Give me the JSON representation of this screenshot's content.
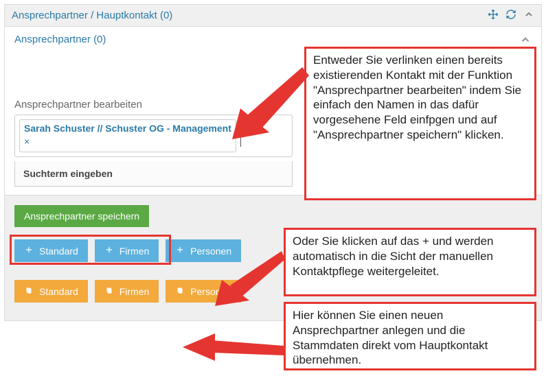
{
  "panel": {
    "title": "Ansprechpartner / Hauptkontakt (0)"
  },
  "sub": {
    "title": "Ansprechpartner (0)"
  },
  "edit": {
    "label": "Ansprechpartner bearbeiten",
    "tag": "Sarah Schuster // Schuster OG - Management",
    "search_placeholder": "Suchterm eingeben"
  },
  "buttons": {
    "save": "Ansprechpartner speichern",
    "add_standard": "Standard",
    "add_firmen": "Firmen",
    "add_personen": "Personen",
    "copy_standard": "Standard",
    "copy_firmen": "Firmen",
    "copy_personen": "Personen"
  },
  "annotations": {
    "a1": "Entweder Sie verlinken einen bereits existierenden Kontakt mit der Funktion \"Ansprechpartner bearbeiten\" indem Sie einfach den Namen in das dafür vorgesehene Feld einfpgen und auf \"Ansprechpartner speichern\" klicken.",
    "a2": "Oder Sie klicken auf das + und werden automatisch in die Sicht der manuellen Kontaktpflege weitergeleitet.",
    "a3": "Hier können Sie einen neuen Ansprechpartner anlegen und die Stammdaten direkt vom Hauptkontakt übernehmen."
  }
}
